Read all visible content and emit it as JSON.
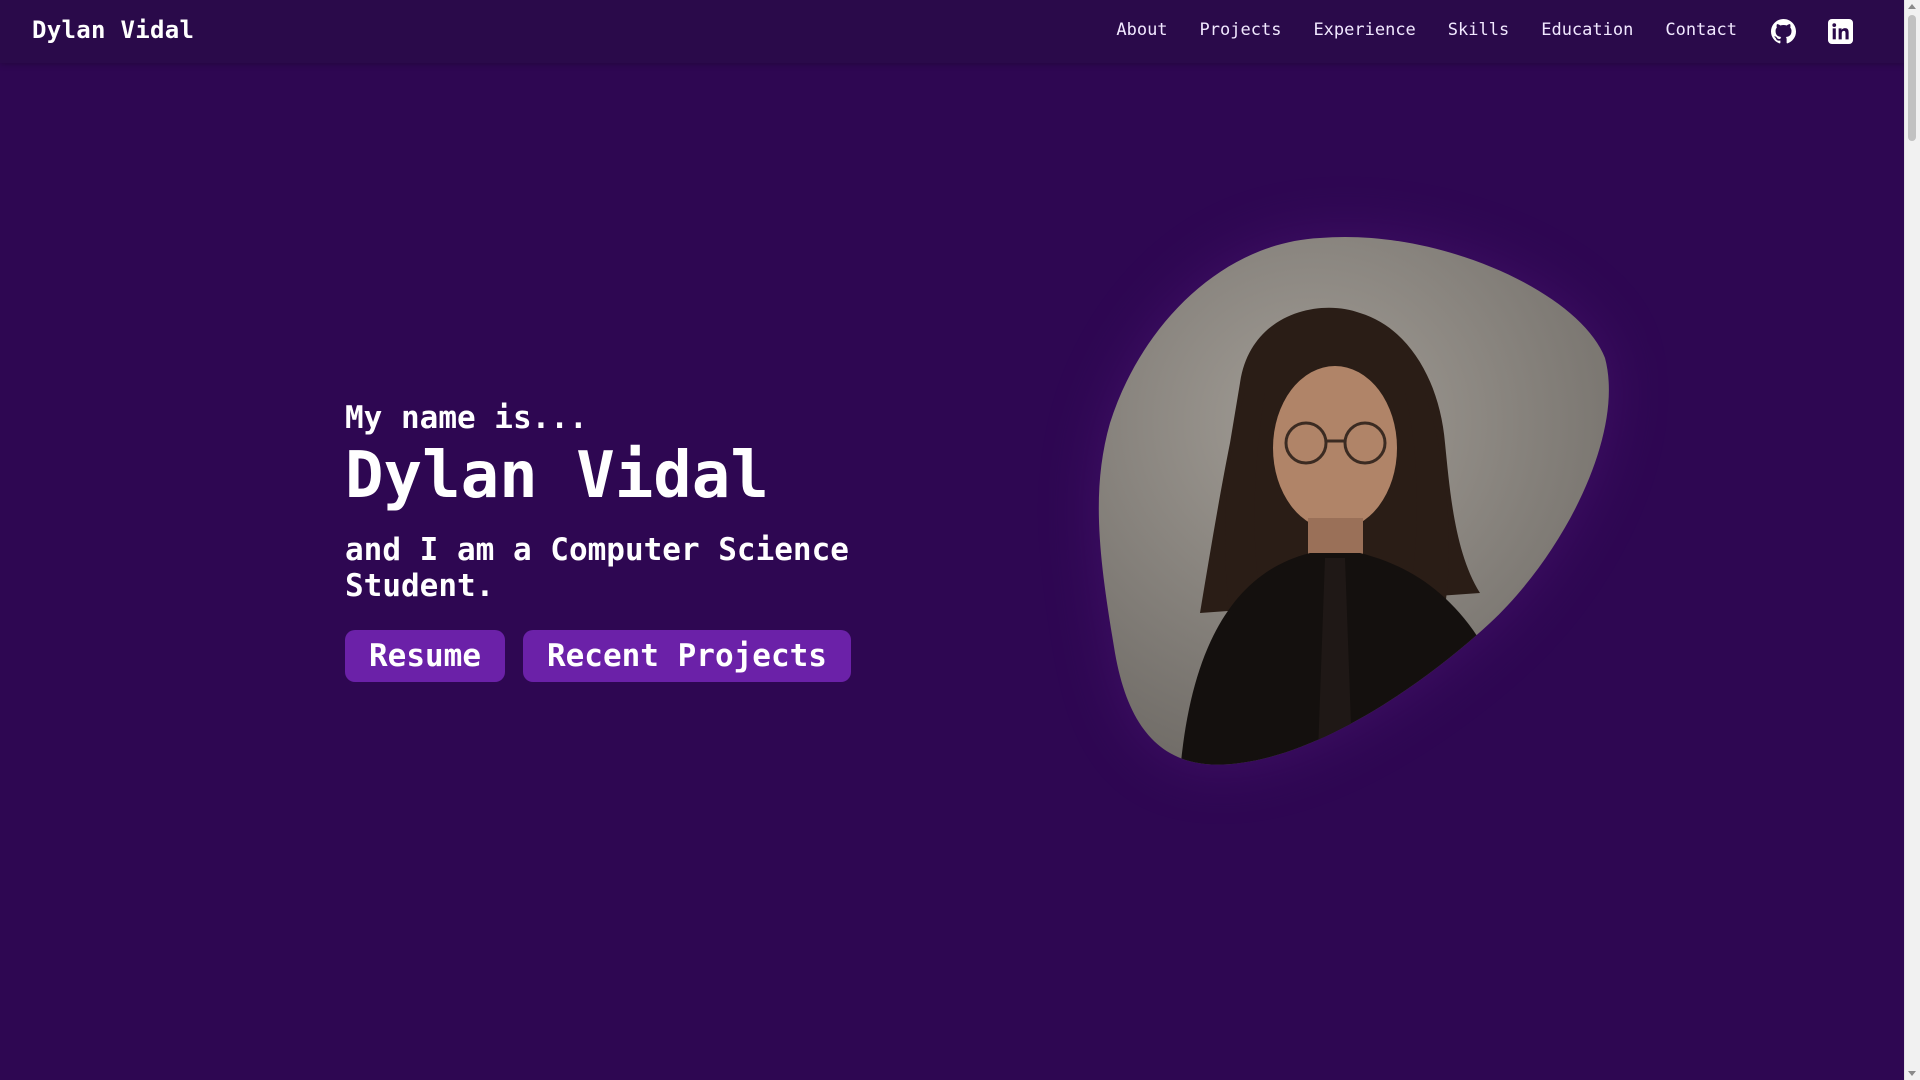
{
  "navbar": {
    "brand": "Dylan Vidal",
    "links": [
      "About",
      "Projects",
      "Experience",
      "Skills",
      "Education",
      "Contact"
    ],
    "icons": [
      "github-icon",
      "linkedin-icon"
    ]
  },
  "hero": {
    "intro": "My name is...",
    "name": "Dylan Vidal",
    "role": "and I am a Computer Science Student.",
    "buttons": {
      "resume": "Resume",
      "projects": "Recent Projects"
    },
    "portrait": "profile-photo"
  },
  "colors": {
    "background": "#2e0752",
    "navbar": "#2a0a4a",
    "button": "#6b21a8",
    "text": "#ffffff"
  }
}
